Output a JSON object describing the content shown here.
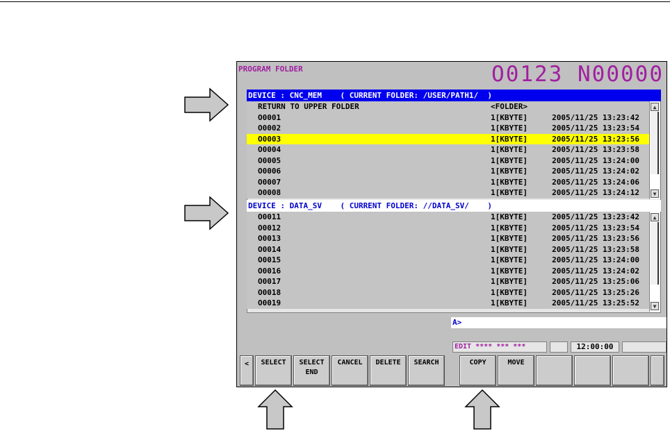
{
  "screen": {
    "title": "PROGRAM FOLDER",
    "program_number": "O0123 N00000"
  },
  "pane1": {
    "header": "DEVICE : CNC_MEM    ( CURRENT FOLDER: /USER/PATH1/  )",
    "rows": [
      {
        "name": "RETURN TO UPPER FOLDER",
        "size": "<FOLDER>",
        "date": ""
      },
      {
        "name": "O0001",
        "size": "1[KBYTE]",
        "date": "2005/11/25 13:23:42"
      },
      {
        "name": "O0002",
        "size": "1[KBYTE]",
        "date": "2005/11/25 13:23:54"
      },
      {
        "name": "O0003",
        "size": "1[KBYTE]",
        "date": "2005/11/25 13:23:56"
      },
      {
        "name": "O0004",
        "size": "1[KBYTE]",
        "date": "2005/11/25 13:23:58"
      },
      {
        "name": "O0005",
        "size": "1[KBYTE]",
        "date": "2005/11/25 13:24:00"
      },
      {
        "name": "O0006",
        "size": "1[KBYTE]",
        "date": "2005/11/25 13:24:02"
      },
      {
        "name": "O0007",
        "size": "1[KBYTE]",
        "date": "2005/11/25 13:24:06"
      },
      {
        "name": "O0008",
        "size": "1[KBYTE]",
        "date": "2005/11/25 13:24:12"
      }
    ]
  },
  "pane2": {
    "header": "DEVICE : DATA_SV    ( CURRENT FOLDER: //DATA_SV/    )",
    "rows": [
      {
        "name": "O0011",
        "size": "1[KBYTE]",
        "date": "2005/11/25 13:23:42"
      },
      {
        "name": "O0012",
        "size": "1[KBYTE]",
        "date": "2005/11/25 13:23:54"
      },
      {
        "name": "O0013",
        "size": "1[KBYTE]",
        "date": "2005/11/25 13:23:56"
      },
      {
        "name": "O0014",
        "size": "1[KBYTE]",
        "date": "2005/11/25 13:23:58"
      },
      {
        "name": "O0015",
        "size": "1[KBYTE]",
        "date": "2005/11/25 13:24:00"
      },
      {
        "name": "O0016",
        "size": "1[KBYTE]",
        "date": "2005/11/25 13:24:02"
      },
      {
        "name": "O0017",
        "size": "1[KBYTE]",
        "date": "2005/11/25 13:25:06"
      },
      {
        "name": "O0018",
        "size": "1[KBYTE]",
        "date": "2005/11/25 13:25:26"
      },
      {
        "name": "O0019",
        "size": "1[KBYTE]",
        "date": "2005/11/25 13:25:52"
      }
    ]
  },
  "input_prompt": "A>",
  "status": {
    "mode": "EDIT **** *** ***",
    "time": "12:00:00"
  },
  "softkeys": {
    "left_nav": "<",
    "select": "SELECT",
    "select_end": "SELECT\nEND",
    "cancel": "CANCEL",
    "delete": "DELETE",
    "search": "SEARCH",
    "copy": "COPY",
    "move": "MOVE"
  },
  "colors": {
    "active_header": "#0000ee",
    "highlight": "#ffff00",
    "title_accent": "#a020a0",
    "arrow_fill": "#c8c8c8"
  },
  "icons": [
    "right-callout-arrow-icon",
    "up-callout-arrow-icon",
    "scroll-up-icon",
    "scroll-down-icon"
  ]
}
